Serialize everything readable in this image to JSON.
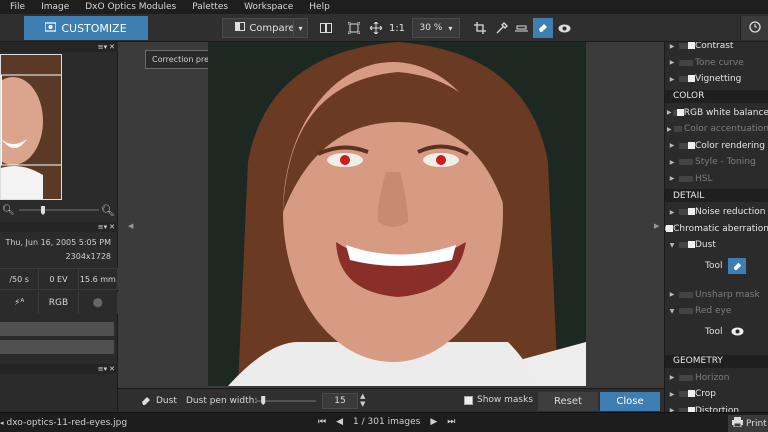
{
  "menu": [
    "File",
    "Image",
    "DxO Optics Modules",
    "Palettes",
    "Workspace",
    "Help"
  ],
  "toolbar": {
    "customize": "CUSTOMIZE",
    "compare": "Compare",
    "zoom_1to1": "1:1",
    "zoom_value": "30 %"
  },
  "tooltip": "Correction preview",
  "left_panel": {
    "date": "Thu, Jun 16, 2005 5:05 PM",
    "dimensions": "2304x1728",
    "shutter": "/50 s",
    "ev": "0 EV",
    "focal": "15.6 mm",
    "colorspace": "RGB"
  },
  "dust_bar": {
    "label": "Dust",
    "pen_label": "Dust pen width:",
    "pen_value": "15",
    "pen_fraction": 0.12,
    "show_masks": "Show masks",
    "reset": "Reset",
    "close": "Close"
  },
  "right_panel": {
    "rows": [
      {
        "label": "Contrast",
        "dim": false,
        "on": true,
        "kind": "row"
      },
      {
        "label": "Tone curve",
        "dim": true,
        "on": false,
        "kind": "row"
      },
      {
        "label": "Vignetting",
        "dim": false,
        "on": true,
        "kind": "row"
      },
      {
        "label": "COLOR",
        "kind": "section"
      },
      {
        "label": "RGB white balance",
        "dim": false,
        "on": true,
        "kind": "row"
      },
      {
        "label": "Color accentuation",
        "dim": true,
        "on": false,
        "kind": "row"
      },
      {
        "label": "Color rendering",
        "dim": false,
        "on": true,
        "kind": "row"
      },
      {
        "label": "Style - Toning",
        "dim": true,
        "on": false,
        "kind": "row"
      },
      {
        "label": "HSL",
        "dim": true,
        "on": false,
        "kind": "row"
      },
      {
        "label": "DETAIL",
        "kind": "section"
      },
      {
        "label": "Noise reduction",
        "dim": false,
        "on": true,
        "kind": "row"
      },
      {
        "label": "Chromatic aberration",
        "dim": false,
        "on": true,
        "kind": "row"
      },
      {
        "label": "Dust",
        "dim": false,
        "on": true,
        "kind": "row",
        "expanded": true
      },
      {
        "label": "Tool",
        "kind": "tool",
        "active": true,
        "icon": "eraser-icon"
      },
      {
        "label": "Unsharp mask",
        "dim": true,
        "on": false,
        "kind": "row"
      },
      {
        "label": "Red eye",
        "dim": true,
        "on": false,
        "kind": "row",
        "expanded": true
      },
      {
        "label": "Tool",
        "kind": "tool",
        "active": false,
        "icon": "eye-icon"
      },
      {
        "label": "GEOMETRY",
        "kind": "section"
      },
      {
        "label": "Horizon",
        "dim": true,
        "on": false,
        "kind": "row"
      },
      {
        "label": "Crop",
        "dim": false,
        "on": true,
        "kind": "row"
      },
      {
        "label": "Distortion",
        "dim": false,
        "on": true,
        "kind": "row"
      }
    ]
  },
  "status": {
    "filename": "dxo-optics-11-red-eyes.jpg",
    "counter": "1 / 301",
    "images_label": "images",
    "print": "Print"
  },
  "colors": {
    "accent": "#3d7fb3",
    "background": "#2b2b2b"
  }
}
